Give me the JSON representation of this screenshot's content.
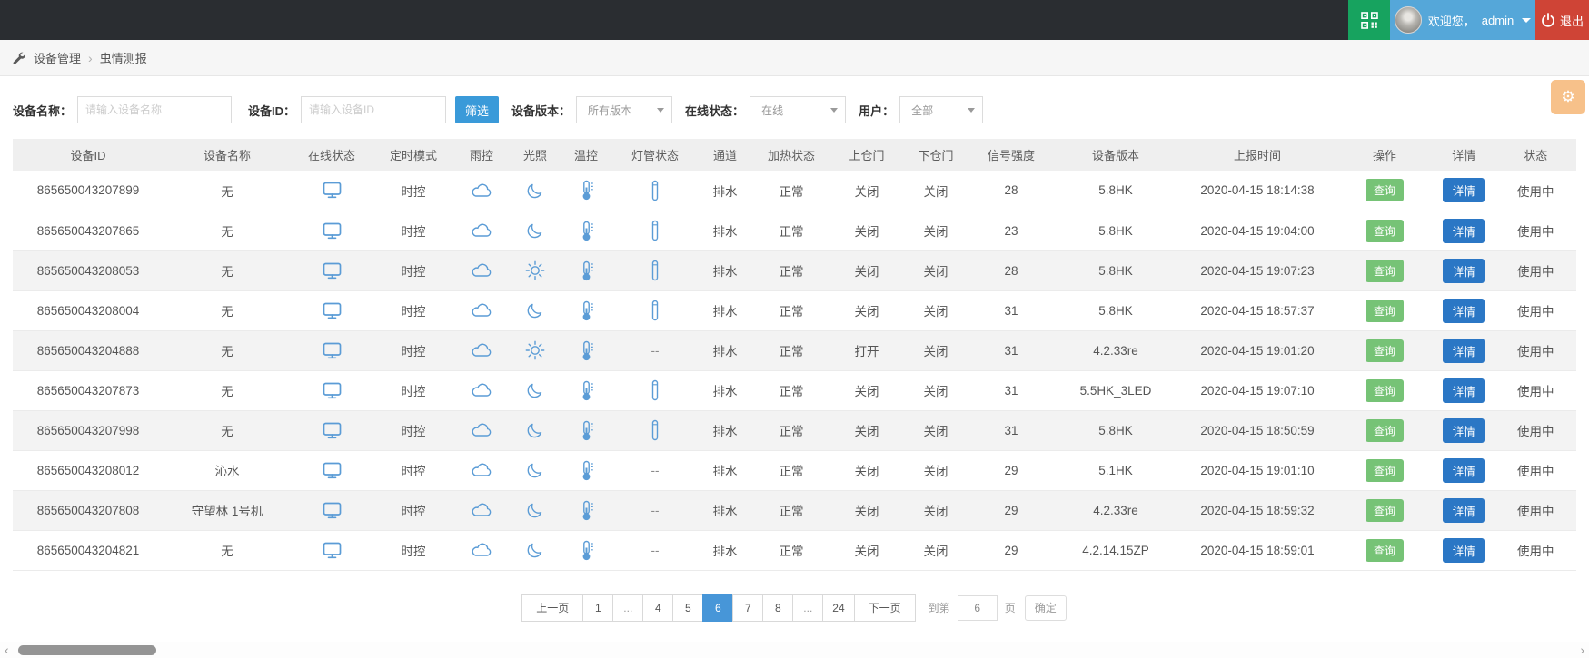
{
  "colors": {
    "topbar_bg": "#2a2d31",
    "qr_green": "#17a35f",
    "user_blue": "#55a7d9",
    "logout_red": "#cf4436",
    "filter_blue": "#3a9ad9",
    "query_green": "#76c376",
    "detail_blue": "#2b77c5",
    "page_active_blue": "#4796d8",
    "icon_blue": "#5b9cd6",
    "gear_orange": "#f6b26d"
  },
  "topbar": {
    "qr_icon": "qr-code-icon",
    "welcome_text": "欢迎您，",
    "username": "admin",
    "logout_label": "退出",
    "power_icon": "power-icon"
  },
  "breadcrumb": {
    "wrench_icon": "wrench-icon",
    "items": [
      "设备管理",
      "虫情测报"
    ],
    "separator": "›"
  },
  "filters": {
    "device_name_label": "设备名称：",
    "device_name_placeholder": "请输入设备名称",
    "device_name_value": "",
    "device_id_label": "设备ID：",
    "device_id_placeholder": "请输入设备ID",
    "device_id_value": "",
    "filter_button": "筛选",
    "version_label": "设备版本：",
    "version_value": "所有版本",
    "online_label": "在线状态：",
    "online_value": "在线",
    "user_label": "用户：",
    "user_value": "全部",
    "gear_icon": "⚙"
  },
  "table": {
    "columns": [
      "设备ID",
      "设备名称",
      "在线状态",
      "定时模式",
      "雨控",
      "光照",
      "温控",
      "灯管状态",
      "通道",
      "加热状态",
      "上仓门",
      "下仓门",
      "信号强度",
      "设备版本",
      "上报时间",
      "操作",
      "详情",
      "状态"
    ],
    "query_label": "查询",
    "detail_label": "详情",
    "rows": [
      {
        "id": "865650043207899",
        "name": "无",
        "online": "monitor",
        "timer": "时控",
        "rain": "cloud",
        "light": "moon",
        "temp": "thermometer",
        "lamp": "tube",
        "channel": "排水",
        "heat": "正常",
        "upper_door": "关闭",
        "lower_door": "关闭",
        "signal": "28",
        "version": "5.8HK",
        "report_time": "2020-04-15 18:14:38",
        "status": "使用中"
      },
      {
        "id": "865650043207865",
        "name": "无",
        "online": "monitor",
        "timer": "时控",
        "rain": "cloud",
        "light": "moon",
        "temp": "thermometer",
        "lamp": "tube",
        "channel": "排水",
        "heat": "正常",
        "upper_door": "关闭",
        "lower_door": "关闭",
        "signal": "23",
        "version": "5.8HK",
        "report_time": "2020-04-15 19:04:00",
        "status": "使用中"
      },
      {
        "id": "865650043208053",
        "name": "无",
        "online": "monitor",
        "timer": "时控",
        "rain": "cloud",
        "light": "sun",
        "temp": "thermometer",
        "lamp": "tube",
        "channel": "排水",
        "heat": "正常",
        "upper_door": "关闭",
        "lower_door": "关闭",
        "signal": "28",
        "version": "5.8HK",
        "report_time": "2020-04-15 19:07:23",
        "status": "使用中"
      },
      {
        "id": "865650043208004",
        "name": "无",
        "online": "monitor",
        "timer": "时控",
        "rain": "cloud",
        "light": "moon",
        "temp": "thermometer",
        "lamp": "tube",
        "channel": "排水",
        "heat": "正常",
        "upper_door": "关闭",
        "lower_door": "关闭",
        "signal": "31",
        "version": "5.8HK",
        "report_time": "2020-04-15 18:57:37",
        "status": "使用中"
      },
      {
        "id": "865650043204888",
        "name": "无",
        "online": "monitor",
        "timer": "时控",
        "rain": "cloud",
        "light": "sun",
        "temp": "thermometer",
        "lamp": "--",
        "channel": "排水",
        "heat": "正常",
        "upper_door": "打开",
        "lower_door": "关闭",
        "signal": "31",
        "version": "4.2.33re",
        "report_time": "2020-04-15 19:01:20",
        "status": "使用中"
      },
      {
        "id": "865650043207873",
        "name": "无",
        "online": "monitor",
        "timer": "时控",
        "rain": "cloud",
        "light": "moon",
        "temp": "thermometer",
        "lamp": "tube",
        "channel": "排水",
        "heat": "正常",
        "upper_door": "关闭",
        "lower_door": "关闭",
        "signal": "31",
        "version": "5.5HK_3LED",
        "report_time": "2020-04-15 19:07:10",
        "status": "使用中"
      },
      {
        "id": "865650043207998",
        "name": "无",
        "online": "monitor",
        "timer": "时控",
        "rain": "cloud",
        "light": "moon",
        "temp": "thermometer",
        "lamp": "tube",
        "channel": "排水",
        "heat": "正常",
        "upper_door": "关闭",
        "lower_door": "关闭",
        "signal": "31",
        "version": "5.8HK",
        "report_time": "2020-04-15 18:50:59",
        "status": "使用中"
      },
      {
        "id": "865650043208012",
        "name": "沁水",
        "online": "monitor",
        "timer": "时控",
        "rain": "cloud",
        "light": "moon",
        "temp": "thermometer",
        "lamp": "--",
        "channel": "排水",
        "heat": "正常",
        "upper_door": "关闭",
        "lower_door": "关闭",
        "signal": "29",
        "version": "5.1HK",
        "report_time": "2020-04-15 19:01:10",
        "status": "使用中"
      },
      {
        "id": "865650043207808",
        "name": "守望林 1号机",
        "online": "monitor",
        "timer": "时控",
        "rain": "cloud",
        "light": "moon",
        "temp": "thermometer",
        "lamp": "--",
        "channel": "排水",
        "heat": "正常",
        "upper_door": "关闭",
        "lower_door": "关闭",
        "signal": "29",
        "version": "4.2.33re",
        "report_time": "2020-04-15 18:59:32",
        "status": "使用中"
      },
      {
        "id": "865650043204821",
        "name": "无",
        "online": "monitor",
        "timer": "时控",
        "rain": "cloud",
        "light": "moon",
        "temp": "thermometer",
        "lamp": "--",
        "channel": "排水",
        "heat": "正常",
        "upper_door": "关闭",
        "lower_door": "关闭",
        "signal": "29",
        "version": "4.2.14.15ZP",
        "report_time": "2020-04-15 18:59:01",
        "status": "使用中"
      }
    ]
  },
  "pagination": {
    "prev": "上一页",
    "next": "下一页",
    "pages": [
      "1",
      "...",
      "4",
      "5",
      "6",
      "7",
      "8",
      "...",
      "24"
    ],
    "active_index": 4,
    "active": "6",
    "goto_prefix": "到第",
    "goto_value": "6",
    "goto_suffix": "页",
    "confirm": "确定"
  },
  "scrollbar": {
    "left_arrow": "‹",
    "right_arrow": "›"
  }
}
